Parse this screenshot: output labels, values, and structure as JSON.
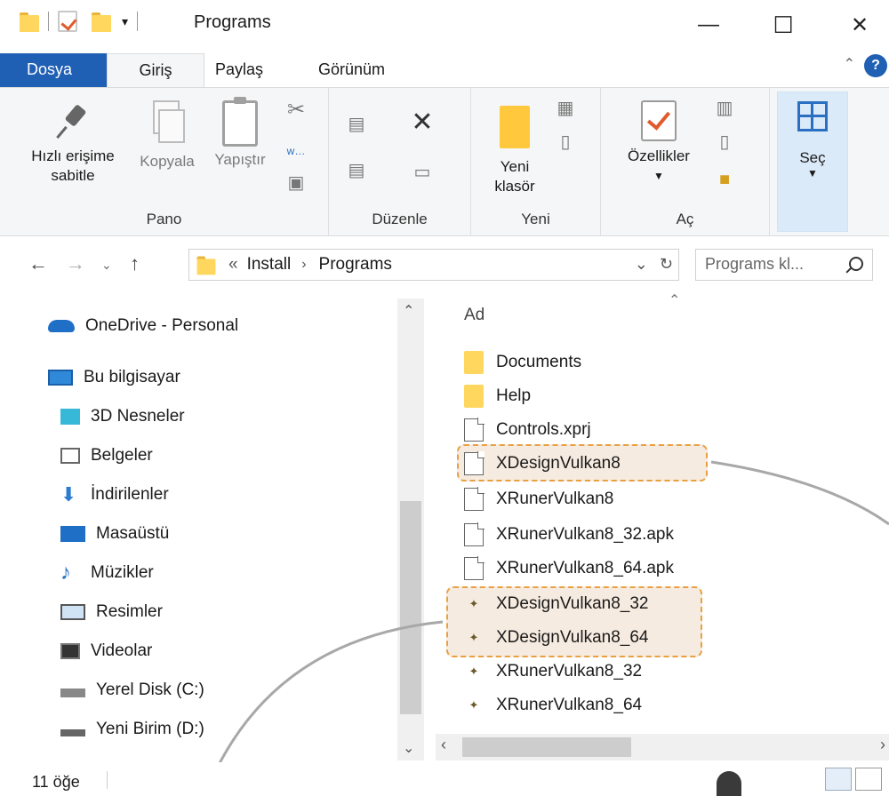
{
  "window": {
    "title": "Programs",
    "minimize": "—",
    "maximize": "☐",
    "close": "✕"
  },
  "ribbon": {
    "tabs": {
      "file": "Dosya",
      "home": "Giriş",
      "share": "Paylaş",
      "view": "Görünüm"
    },
    "help": "?",
    "groups": {
      "clipboard": {
        "label": "Pano",
        "pin_line1": "Hızlı erişime",
        "pin_line2": "sabitle",
        "copy": "Kopyala",
        "paste": "Yapıştır"
      },
      "organize": {
        "label": "Düzenle"
      },
      "new": {
        "label": "Yeni",
        "new_folder_line1": "Yeni",
        "new_folder_line2": "klasör"
      },
      "open": {
        "label": "Aç",
        "properties": "Özellikler"
      },
      "select": {
        "label": "Seç"
      }
    }
  },
  "address": {
    "overflow": "«",
    "crumbs": [
      "Install",
      "Programs"
    ],
    "search_placeholder": "Programs kl..."
  },
  "nav_pane": [
    {
      "label": "OneDrive - Personal",
      "icon": "cloud-icon"
    },
    {
      "label": "Bu bilgisayar",
      "icon": "computer-icon"
    },
    {
      "label": "3D Nesneler",
      "icon": "cube-icon"
    },
    {
      "label": "Belgeler",
      "icon": "documents-icon"
    },
    {
      "label": "İndirilenler",
      "icon": "download-icon"
    },
    {
      "label": "Masaüstü",
      "icon": "desktop-icon"
    },
    {
      "label": "Müzikler",
      "icon": "music-icon"
    },
    {
      "label": "Resimler",
      "icon": "pictures-icon"
    },
    {
      "label": "Videolar",
      "icon": "video-icon"
    },
    {
      "label": "Yerel Disk (C:)",
      "icon": "drive-icon"
    },
    {
      "label": "Yeni Birim (D:)",
      "icon": "drive-icon"
    }
  ],
  "file_list": {
    "column_header": "Ad",
    "items": [
      {
        "name": "Documents",
        "type": "folder"
      },
      {
        "name": "Help",
        "type": "folder"
      },
      {
        "name": "Controls.xprj",
        "type": "file"
      },
      {
        "name": "XDesignVulkan8",
        "type": "file"
      },
      {
        "name": "XRunerVulkan8",
        "type": "file"
      },
      {
        "name": "XRunerVulkan8_32.apk",
        "type": "file"
      },
      {
        "name": "XRunerVulkan8_64.apk",
        "type": "file"
      },
      {
        "name": "XDesignVulkan8_32",
        "type": "exe"
      },
      {
        "name": "XDesignVulkan8_64",
        "type": "exe"
      },
      {
        "name": "XRunerVulkan8_32",
        "type": "exe"
      },
      {
        "name": "XRunerVulkan8_64",
        "type": "exe"
      }
    ]
  },
  "status": {
    "item_count": "11 öğe"
  },
  "colors": {
    "accent": "#1f5fb4",
    "highlight_border": "#e8a040",
    "highlight_fill": "#f6ebe0"
  }
}
